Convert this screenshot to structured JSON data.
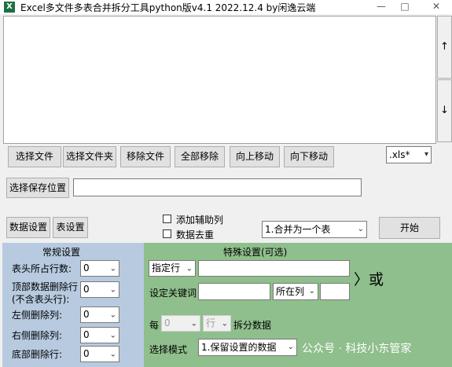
{
  "window": {
    "title": "Excel多文件多表合并拆分工具python版v4.1   2022.12.4 by闲逸云端",
    "app_icon": "X",
    "minimize": "—",
    "maximize": "□",
    "close": "✕"
  },
  "side_buttons": {
    "up": "↑",
    "down": "↓"
  },
  "toolbar": {
    "select_file": "选择文件",
    "select_folder": "选择文件夹",
    "remove_file": "移除文件",
    "remove_all": "全部移除",
    "move_up": "向上移动",
    "move_down": "向下移动",
    "ext_filter": ".xls*"
  },
  "save": {
    "button": "选择保存位置",
    "path": ""
  },
  "actions": {
    "data_settings": "数据设置",
    "table_settings": "表设置",
    "add_helper_col": "添加辅助列",
    "dedupe": "数据去重",
    "mode": "1.合并为一个表",
    "start": "开始"
  },
  "general": {
    "title": "常规设置",
    "header_rows_label": "表头所占行数:",
    "header_rows": "0",
    "top_delete_label_1": "顶部数据删除行",
    "top_delete_label_2": "(不含表头行):",
    "top_delete": "0",
    "left_cols_label": "左侧删除列:",
    "left_cols": "0",
    "right_cols_label": "右侧删除列:",
    "right_cols": "0",
    "bottom_rows_label": "底部删除行:",
    "bottom_rows": "0"
  },
  "special": {
    "title": "特殊设置(可选)",
    "row_select": "指定行",
    "row_value": "",
    "or_text": "〉或",
    "keyword_label": "设定关键词",
    "keyword_value": "",
    "column_select": "所在列",
    "column_value": "",
    "every_label": "每",
    "every_value": "0",
    "unit_select": "行",
    "split_label": "拆分数据",
    "mode_label": "选择模式",
    "mode_value": "1.保留设置的数据"
  },
  "watermark": "公众号 · 科技小东管家"
}
